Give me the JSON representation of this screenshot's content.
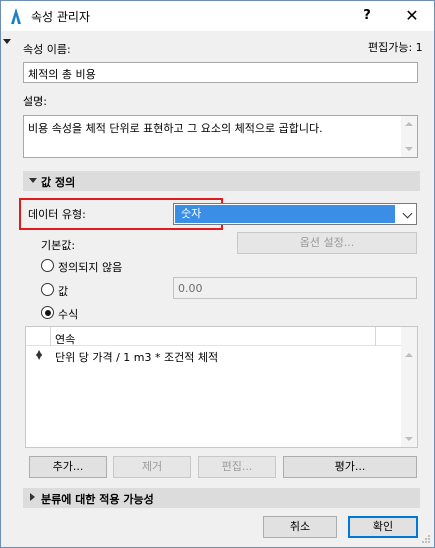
{
  "window": {
    "title": "속성 관리자",
    "help_label": "?",
    "close_label": "✕"
  },
  "header": {
    "name_label": "속성 이름:",
    "editable_label": "편집가능: 1",
    "name_value": "체적의 총 비용",
    "description_label": "설명:",
    "description_value": "비용 속성을 체적 단위로 표현하고 그 요소의 체적으로 곱합니다."
  },
  "value_definition": {
    "section_title": "값 정의",
    "data_type_label": "데이터 유형:",
    "data_type_value": "숫자",
    "default_label": "기본값:",
    "option_settings_label": "옵션 설정...",
    "radio_undefined": "정의되지 않음",
    "radio_value": "값",
    "radio_formula": "수식",
    "value_field": "0.00",
    "selected_radio": "formula",
    "formula_header": "연속",
    "formula_text": "단위 당 가격 / 1 m3 * 조건적 체적",
    "add_label": "추가...",
    "remove_label": "제거",
    "edit_label": "편집...",
    "evaluate_label": "평가..."
  },
  "classification": {
    "section_title": "분류에 대한 적용 가능성"
  },
  "footer": {
    "cancel_label": "취소",
    "ok_label": "확인"
  },
  "colors": {
    "accent": "#0078d7",
    "selection": "#3a8ee6",
    "highlight_box": "#e11b1b"
  }
}
